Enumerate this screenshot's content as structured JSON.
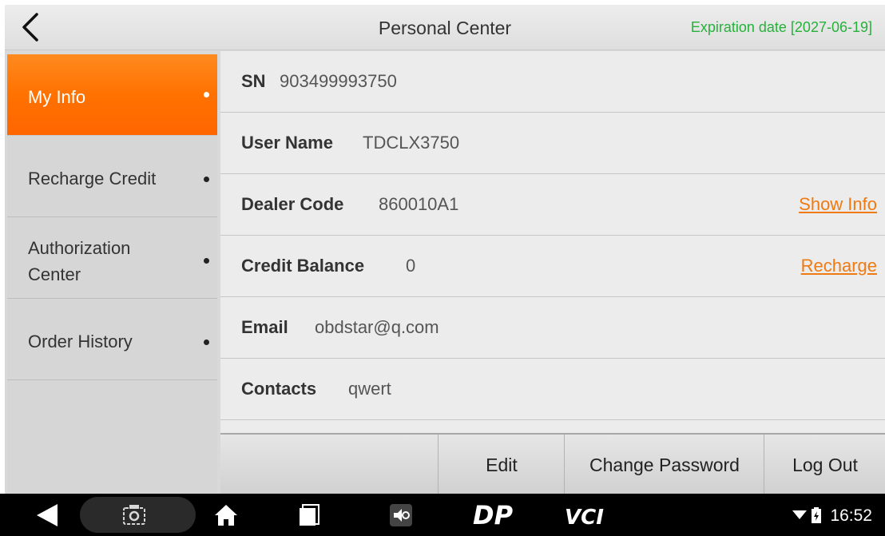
{
  "header": {
    "title": "Personal Center",
    "expiration": "Expiration date [2027-06-19]",
    "back_icon": "chevron-left-icon",
    "expiration_color": "#25b13a"
  },
  "sidebar": {
    "items": [
      {
        "label": "My Info",
        "active": true
      },
      {
        "label": "Recharge Credit",
        "active": false
      },
      {
        "label": "Authorization Center",
        "active": false
      },
      {
        "label": "Order History",
        "active": false
      }
    ],
    "accent_color": "#ff7200"
  },
  "info": {
    "rows": [
      {
        "key": "SN",
        "value": "903499993750"
      },
      {
        "key": "User Name",
        "value": "TDCLX3750"
      },
      {
        "key": "Dealer Code",
        "value": "860010A1",
        "link": "Show Info"
      },
      {
        "key": "Credit Balance",
        "value": "0",
        "link": "Recharge"
      },
      {
        "key": "Email",
        "value": "obdstar@q.com"
      },
      {
        "key": "Contacts",
        "value": "qwert"
      }
    ],
    "link_color": "#f07a12"
  },
  "actions": {
    "edit": "Edit",
    "change_password": "Change Password",
    "log_out": "Log Out"
  },
  "system_bar": {
    "time": "16:52",
    "icons": [
      "back-icon",
      "screenshot-icon",
      "home-icon",
      "recents-icon",
      "app-icon",
      "dp-icon",
      "vci-icon",
      "wifi-icon",
      "battery-icon"
    ],
    "dp_label": "DP",
    "vci_label": "VCI"
  }
}
